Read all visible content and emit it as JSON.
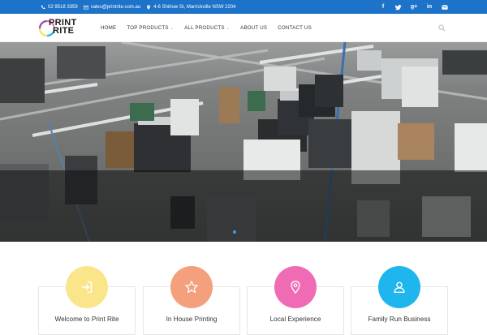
{
  "topbar": {
    "phone": "02 9518 3359",
    "email": "sales@printrite.com.au",
    "address": "4-6 Shirlow St, Marrickville NSW 2204",
    "social": [
      {
        "name": "facebook-icon",
        "glyph": "f"
      },
      {
        "name": "twitter-icon",
        "glyph": "t"
      },
      {
        "name": "google-plus-icon",
        "glyph": "g+"
      },
      {
        "name": "linkedin-icon",
        "glyph": "in"
      },
      {
        "name": "mail-icon",
        "glyph": "✉"
      }
    ]
  },
  "logo": {
    "line1": "PRINT",
    "line2": "RITE"
  },
  "nav": {
    "items": [
      {
        "label": "HOME"
      },
      {
        "label": "TOP PRODUCTS",
        "dropdown": true
      },
      {
        "label": "ALL PRODUCTS",
        "dropdown": true
      },
      {
        "label": "ABOUT US"
      },
      {
        "label": "CONTACT US"
      }
    ]
  },
  "features": [
    {
      "title": "Welcome to Print Rite",
      "color": "#fbe58a",
      "icon": "sign-in-icon"
    },
    {
      "title": "In House Printing",
      "color": "#f4a07c",
      "icon": "star-icon"
    },
    {
      "title": "Local Experience",
      "color": "#ef6cb5",
      "icon": "location-pin-icon"
    },
    {
      "title": "Family Run Business",
      "color": "#1fb6ee",
      "icon": "users-icon"
    }
  ],
  "colors": {
    "topbar": "#1d73c9",
    "accent": "#1d73c9"
  }
}
